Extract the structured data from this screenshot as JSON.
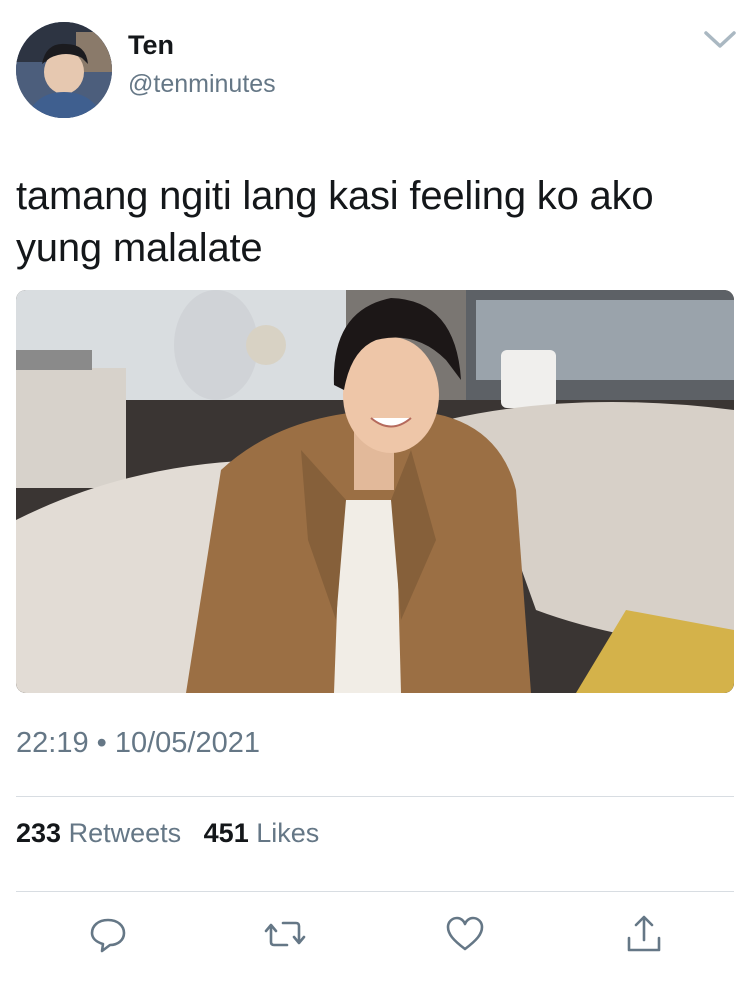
{
  "author": {
    "display_name": "Ten",
    "handle": "@tenminutes",
    "avatar_icon": "profile-photo"
  },
  "tweet": {
    "text": "tamang ngiti lang kasi feeling ko ako yung malalate",
    "timestamp": "22:19 • 10/05/2021"
  },
  "stats": {
    "retweets_count": "233",
    "retweets_label": "Retweets",
    "likes_count": "451",
    "likes_label": "Likes"
  },
  "actions": {
    "reply_icon": "reply-icon",
    "retweet_icon": "retweet-icon",
    "like_icon": "heart-icon",
    "share_icon": "share-icon"
  },
  "colors": {
    "text_primary": "#14171a",
    "text_secondary": "#657786",
    "divider": "#d8dde2",
    "icon": "#657786"
  }
}
